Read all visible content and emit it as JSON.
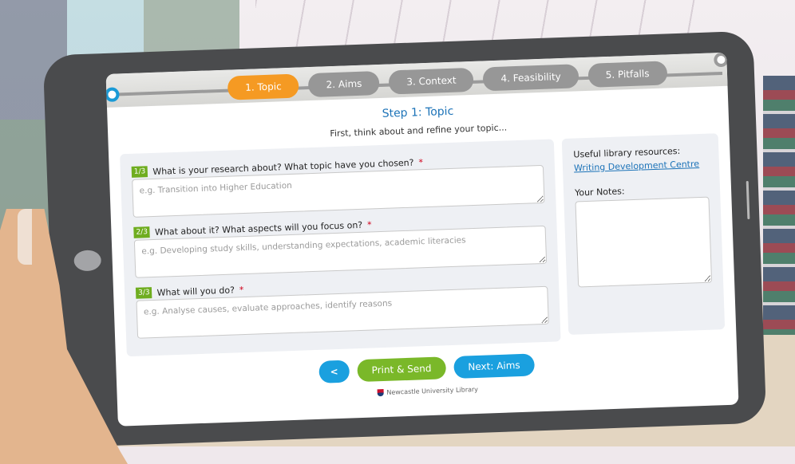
{
  "app": {
    "steps": [
      {
        "label": "1. Topic",
        "active": true
      },
      {
        "label": "2. Aims",
        "active": false
      },
      {
        "label": "3. Context",
        "active": false
      },
      {
        "label": "4. Feasibility",
        "active": false
      },
      {
        "label": "5. Pitfalls",
        "active": false
      }
    ],
    "title": "Step 1: Topic",
    "subtitle": "First, think about and refine your topic...",
    "questions": [
      {
        "badge": "1/3",
        "label": "What is your research about? What topic have you chosen?",
        "required": "*",
        "placeholder": "e.g. Transition into Higher Education",
        "value": ""
      },
      {
        "badge": "2/3",
        "label": "What about it? What aspects will you focus on?",
        "required": "*",
        "placeholder": "e.g. Developing study skills, understanding expectations, academic literacies",
        "value": ""
      },
      {
        "badge": "3/3",
        "label": "What will you do?",
        "required": "*",
        "placeholder": "e.g. Analyse causes, evaluate approaches, identify reasons",
        "value": ""
      }
    ],
    "sidebar": {
      "resources_label": "Useful library resources:",
      "resource_link": "Writing Development Centre",
      "notes_label": "Your Notes:",
      "notes_value": ""
    },
    "actions": {
      "back_label": "<",
      "print_label": "Print & Send",
      "next_label": "Next: Aims"
    },
    "footer": "Newcastle University Library",
    "colors": {
      "active_step": "#f59a23",
      "inactive_step": "#979797",
      "primary_blue": "#1aa0df",
      "green": "#7ab829",
      "badge_green": "#6fad1f",
      "title_blue": "#1c73b8",
      "required_red": "#d0021b"
    }
  }
}
